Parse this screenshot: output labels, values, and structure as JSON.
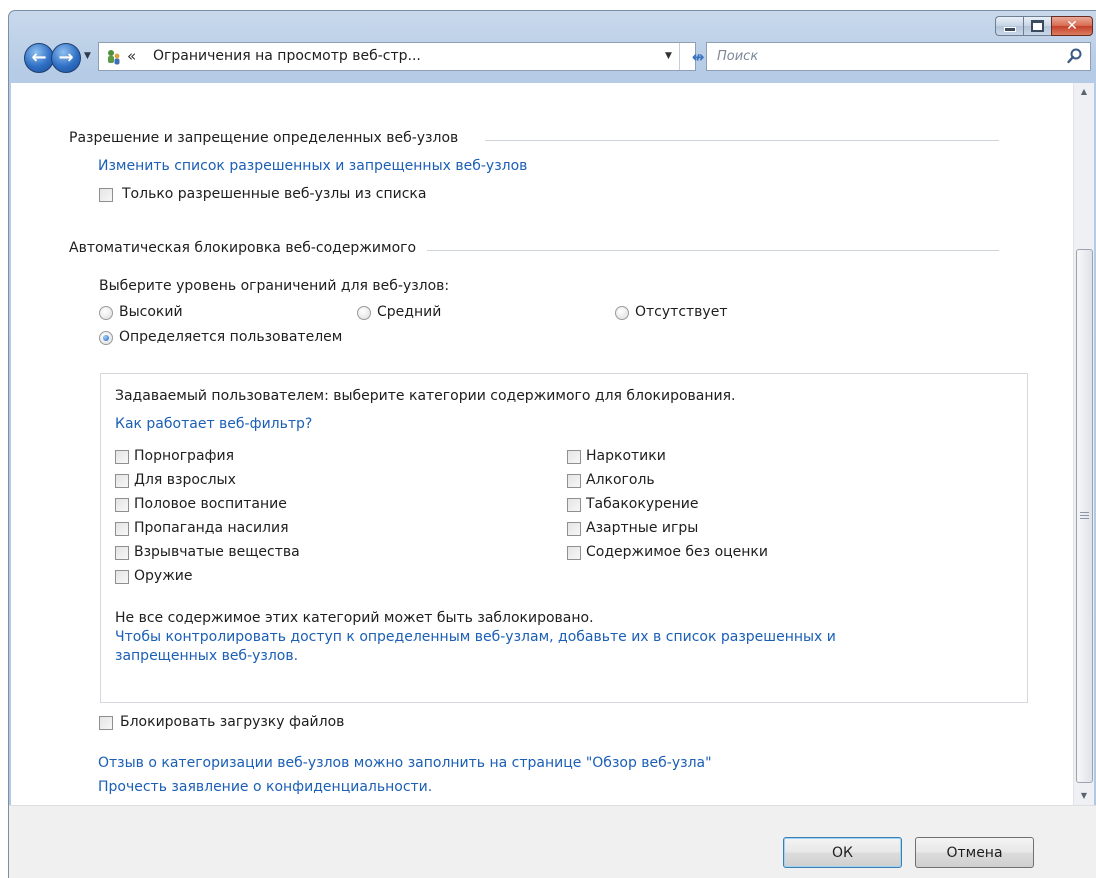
{
  "window": {
    "caption_buttons": {
      "minimize": "minimize-icon",
      "maximize": "maximize-icon",
      "close": "✕"
    }
  },
  "address_bar": {
    "back_icon": "back-arrow-icon",
    "forward_icon": "forward-arrow-icon",
    "breadcrumb_chevron": "«",
    "path_text": "Ограничения на просмотр веб-стр...",
    "refresh_icon": "refresh-icon"
  },
  "search": {
    "placeholder": "Поиск"
  },
  "section_allow_block": {
    "header": "Разрешение и запрещение определенных веб-узлов",
    "edit_list_link": "Изменить список разрешенных и  запрещенных веб-узлов",
    "only_allowed_checkbox": {
      "label": "Только разрешенные веб-узлы из списка",
      "checked": false
    }
  },
  "section_auto_block": {
    "header": "Автоматическая блокировка веб-содержимого",
    "level_prompt": "Выберите уровень ограничений для веб-узлов:",
    "levels": [
      {
        "label": "Высокий",
        "selected": false
      },
      {
        "label": "Средний",
        "selected": false
      },
      {
        "label": "Отсутствует",
        "selected": false
      },
      {
        "label": "Определяется пользователем",
        "selected": true
      }
    ]
  },
  "custom_box": {
    "description": "Задаваемый пользователем:  выберите категории содержимого для блокирования.",
    "how_link": "Как работает веб-фильтр?",
    "categories_left": [
      {
        "label": "Порнография",
        "checked": false
      },
      {
        "label": "Для взрослых",
        "checked": false
      },
      {
        "label": "Половое воспитание",
        "checked": false
      },
      {
        "label": "Пропаганда насилия",
        "checked": false
      },
      {
        "label": "Взрывчатые вещества",
        "checked": false
      },
      {
        "label": "Оружие",
        "checked": false
      }
    ],
    "categories_right": [
      {
        "label": "Наркотики",
        "checked": false
      },
      {
        "label": "Алкоголь",
        "checked": false
      },
      {
        "label": "Табакокурение",
        "checked": false
      },
      {
        "label": "Азартные игры",
        "checked": false
      },
      {
        "label": "Содержимое без оценки",
        "checked": false
      }
    ],
    "note": "Не все содержимое этих категорий может быть заблокировано.",
    "control_link_line1": "Чтобы контролировать доступ к определенным веб-узлам, добавьте их в список разрешенных и",
    "control_link_line2": "запрещенных веб-узлов."
  },
  "block_downloads": {
    "label": "Блокировать загрузку файлов",
    "checked": false
  },
  "footer_links": {
    "feedback": "Отзыв о категоризации веб-узлов можно заполнить на странице \"Обзор веб-узла\"",
    "privacy": "Прочесть заявление о конфиденциальности."
  },
  "buttons": {
    "ok": "ОК",
    "cancel": "Отмена"
  },
  "colors": {
    "link": "#1b5fb6",
    "titlebar": "#bcd0e7",
    "close": "#c5402a"
  }
}
